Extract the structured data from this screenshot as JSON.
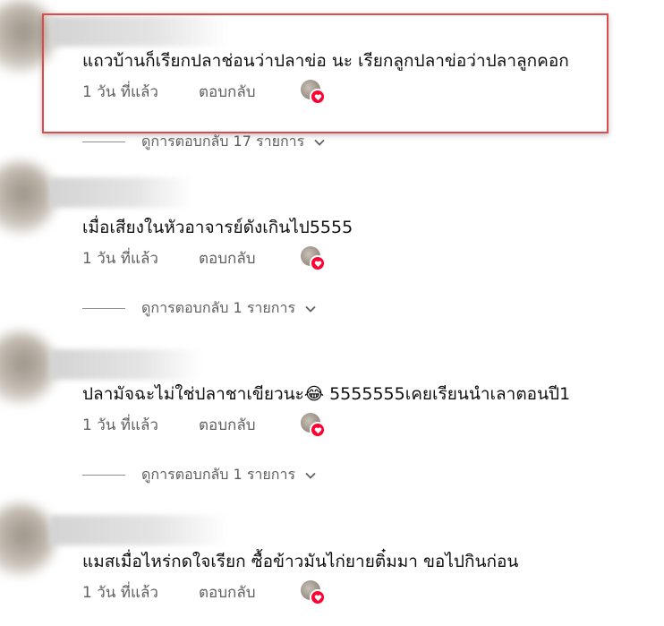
{
  "comments": [
    {
      "text": "แถวบ้านก็เรียกปลาช่อนว่าปลาข่อ นะ เรียกลูกปลาข่อว่าปลาลูกคอก",
      "time": "1 วัน ที่แล้ว",
      "reply_label": "ตอบกลับ",
      "replies_label": "ดูการตอบกลับ 17 รายการ"
    },
    {
      "text": "เมื่อเสียงในหัวอาจารย์ดังเกินไป5555",
      "time": "1 วัน ที่แล้ว",
      "reply_label": "ตอบกลับ",
      "replies_label": "ดูการตอบกลับ 1 รายการ"
    },
    {
      "text": "ปลามัจฉะไม่ใช่ปลาชาเขียวนะ😂 5555555เคยเรียนนำเลาตอนปี1",
      "time": "1 วัน ที่แล้ว",
      "reply_label": "ตอบกลับ",
      "replies_label": "ดูการตอบกลับ 1 รายการ"
    },
    {
      "text": "แมสเมื่อไหร่กดใจเรียก ซื้อข้าวมันไก่ยายติ๋มมา ขอไปกินก่อน",
      "time": "1 วัน ที่แล้ว",
      "reply_label": "ตอบกลับ"
    }
  ],
  "colors": {
    "highlight": "#e14a4a",
    "heart_badge": "#ff0033",
    "meta_text": "#606060"
  },
  "icons": {
    "heart": "heart-icon",
    "chevron": "chevron-down-icon"
  }
}
